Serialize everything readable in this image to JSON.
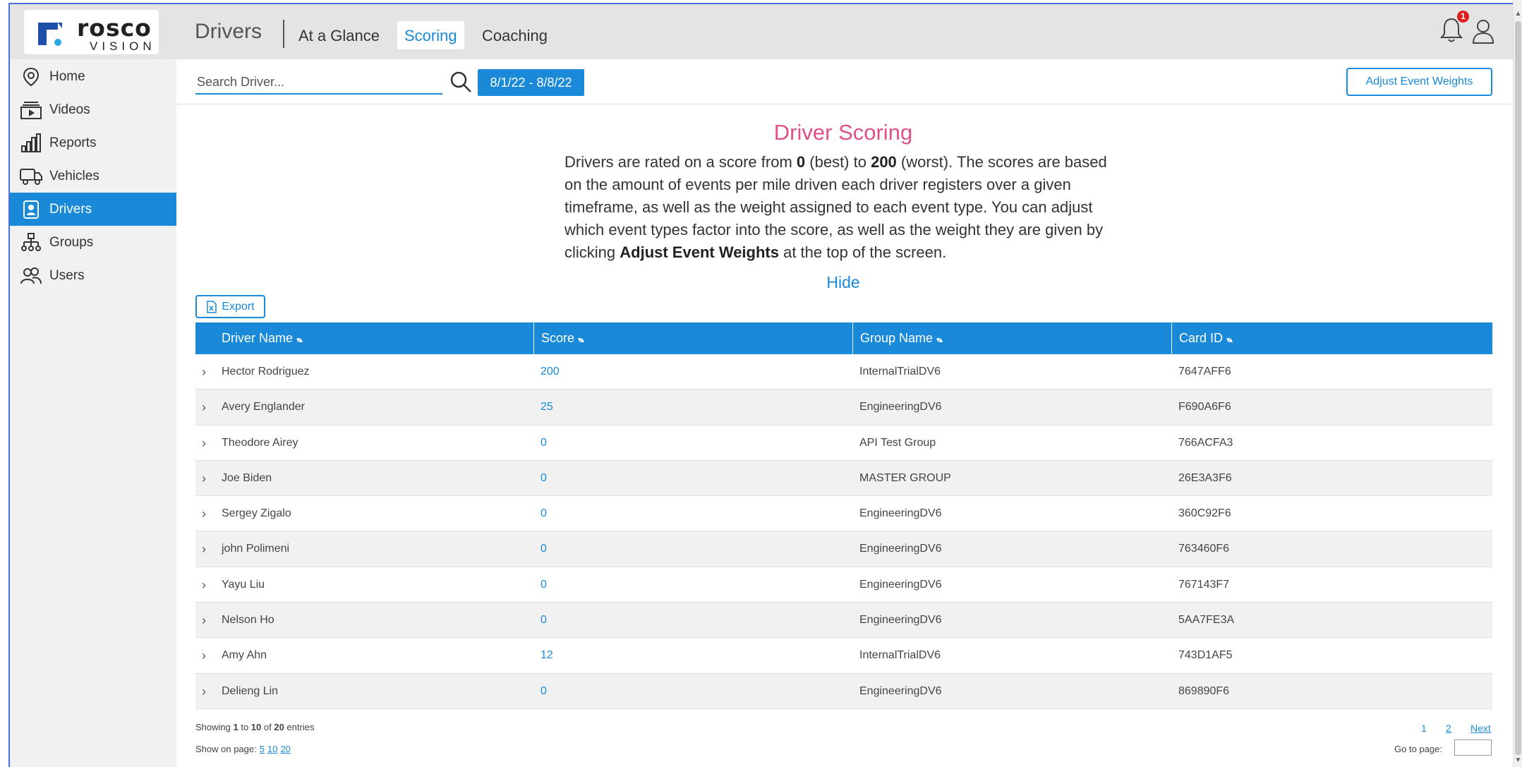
{
  "brand": {
    "name": "rosco",
    "sub": "VISION",
    "colors": {
      "accent": "#1a8ad8",
      "title_pink": "#e0508a",
      "logo_blue": "#1f4fa8",
      "logo_dot": "#29a9e1"
    }
  },
  "header": {
    "section_title": "Drivers",
    "tabs": [
      {
        "label": "At a Glance",
        "active": false
      },
      {
        "label": "Scoring",
        "active": true
      },
      {
        "label": "Coaching",
        "active": false
      }
    ],
    "notification_count": "1",
    "icons": [
      "bell-icon",
      "user-icon"
    ]
  },
  "sidebar": {
    "items": [
      {
        "label": "Home",
        "icon": "map-pin-icon",
        "active": false
      },
      {
        "label": "Videos",
        "icon": "video-icon",
        "active": false
      },
      {
        "label": "Reports",
        "icon": "bar-chart-icon",
        "active": false
      },
      {
        "label": "Vehicles",
        "icon": "truck-icon",
        "active": false
      },
      {
        "label": "Drivers",
        "icon": "driver-badge-icon",
        "active": true
      },
      {
        "label": "Groups",
        "icon": "hierarchy-icon",
        "active": false
      },
      {
        "label": "Users",
        "icon": "users-icon",
        "active": false
      }
    ]
  },
  "toolbar": {
    "search_placeholder": "Search Driver...",
    "date_range": "8/1/22 - 8/8/22",
    "adjust_label": "Adjust Event Weights"
  },
  "intro": {
    "title": "Driver Scoring",
    "text_1": "Drivers are rated on a score from ",
    "best_value": "0",
    "text_2": " (best) to ",
    "worst_value": "200",
    "text_3": " (worst). The scores are based on the amount of events per mile driven each driver registers over a given timeframe, as well as the weight assigned to each event type. You can adjust which event types factor into the score, as well as the weight they are given by clicking ",
    "emphasis": "Adjust Event Weights",
    "text_4": " at the top of the screen.",
    "hide_label": "Hide"
  },
  "export_label": "Export",
  "table": {
    "columns": [
      "Driver Name",
      "Score",
      "Group Name",
      "Card ID"
    ],
    "rows": [
      {
        "name": "Hector Rodriguez",
        "score": "200",
        "group": "InternalTrialDV6",
        "card": "7647AFF6"
      },
      {
        "name": "Avery Englander",
        "score": "25",
        "group": "EngineeringDV6",
        "card": "F690A6F6"
      },
      {
        "name": "Theodore Airey",
        "score": "0",
        "group": "API Test Group",
        "card": "766ACFA3"
      },
      {
        "name": "Joe Biden",
        "score": "0",
        "group": "MASTER GROUP",
        "card": "26E3A3F6"
      },
      {
        "name": "Sergey Zigalo",
        "score": "0",
        "group": "EngineeringDV6",
        "card": "360C92F6"
      },
      {
        "name": "john Polimeni",
        "score": "0",
        "group": "EngineeringDV6",
        "card": "763460F6"
      },
      {
        "name": "Yayu Liu",
        "score": "0",
        "group": "EngineeringDV6",
        "card": "767143F7"
      },
      {
        "name": "Nelson Ho",
        "score": "0",
        "group": "EngineeringDV6",
        "card": "5AA7FE3A"
      },
      {
        "name": "Amy Ahn",
        "score": "12",
        "group": "InternalTrialDV6",
        "card": "743D1AF5"
      },
      {
        "name": "Delieng Lin",
        "score": "0",
        "group": "EngineeringDV6",
        "card": "869890F6"
      }
    ]
  },
  "footer": {
    "showing_prefix": "Showing ",
    "from": "1",
    "to_word": " to ",
    "to": "10",
    "of_word": " of ",
    "total": "20",
    "suffix": " entries",
    "show_on_label": "Show on page:",
    "page_sizes": [
      "5",
      "10",
      "20"
    ],
    "pages": [
      "1",
      "2"
    ],
    "next_label": "Next",
    "goto_label": "Go to page:"
  }
}
